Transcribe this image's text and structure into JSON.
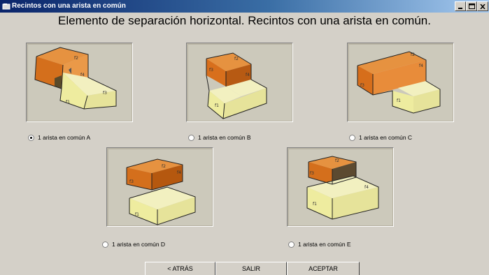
{
  "window": {
    "title": "Recintos con una arista en común",
    "icon": "window-app-icon",
    "controls": [
      "minimize-icon",
      "maximize-icon",
      "close-icon"
    ]
  },
  "heading": "Elemento de separación horizontal. Recintos con una arista en común.",
  "options": [
    {
      "id": "a",
      "label": "1 arista en común A",
      "selected": true
    },
    {
      "id": "b",
      "label": "1 arista en común B",
      "selected": false
    },
    {
      "id": "c",
      "label": "1 arista en común C",
      "selected": false
    },
    {
      "id": "d",
      "label": "1 arista en común D",
      "selected": false
    },
    {
      "id": "e",
      "label": "1 arista en común E",
      "selected": false
    }
  ],
  "diagram_labels": {
    "f1": "f1",
    "f2": "f2",
    "f3": "f3",
    "f4": "f4"
  },
  "buttons": {
    "back": "< ATRÁS",
    "exit": "SALIR",
    "accept": "ACEPTAR"
  },
  "colors": {
    "titlebar_start": "#0a246a",
    "face_background": "#d4d0c8",
    "orange_box": "#e07a2a",
    "yellow_box": "#eceaa0"
  }
}
